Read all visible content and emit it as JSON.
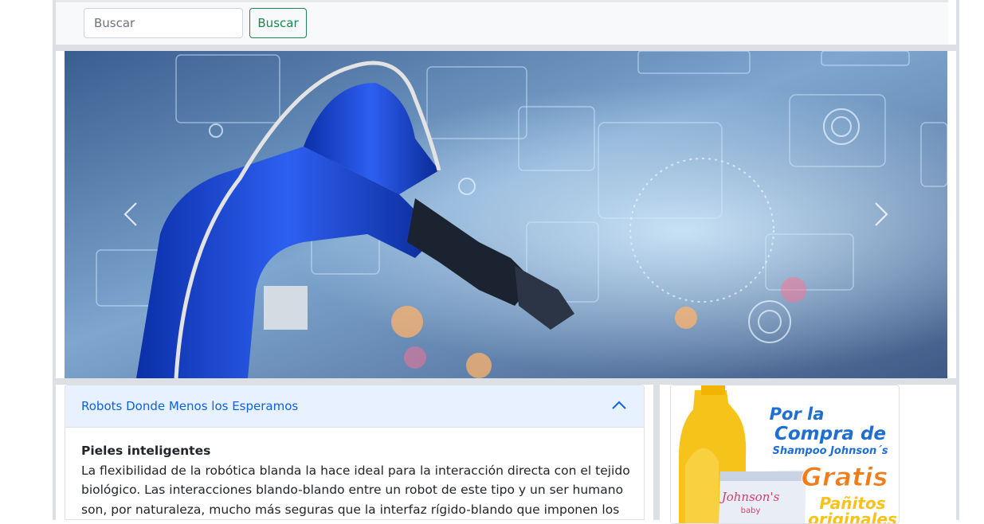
{
  "search": {
    "placeholder": "Buscar",
    "button_label": "Buscar"
  },
  "carousel": {
    "image_alt": "robot-arm-technology-image",
    "prev_icon": "chevron-left-icon",
    "next_icon": "chevron-right-icon"
  },
  "accordion": {
    "title": "Robots Donde Menos los Esperamos",
    "chevron_icon": "chevron-up-icon",
    "body_heading": "Pieles inteligentes",
    "body_text": "La flexibilidad de la robótica blanda la hace ideal para la interacción directa con el tejido biológico. Las interacciones blando-blando entre un robot de este tipo y un ser humano son, por naturaleza, mucho más seguras que la interfaz rígido-blando que imponen los robots rígidos"
  },
  "ad": {
    "line1": "Por la",
    "line2": "Compra de",
    "line3": "Shampoo Johnson´s",
    "line4": "Gratis",
    "line5": "Pañitos",
    "line6": "originales",
    "brand": "Johnson's",
    "brand_sub": "baby",
    "colors": {
      "blue": "#1f6fd1",
      "orange": "#f07d1a",
      "bottle": "#f6c31a"
    }
  },
  "colors": {
    "accent_green": "#198754",
    "accordion_header": "#e7f1ff",
    "accordion_title": "#0c63e4",
    "frame_gray": "#dcdfe3"
  }
}
